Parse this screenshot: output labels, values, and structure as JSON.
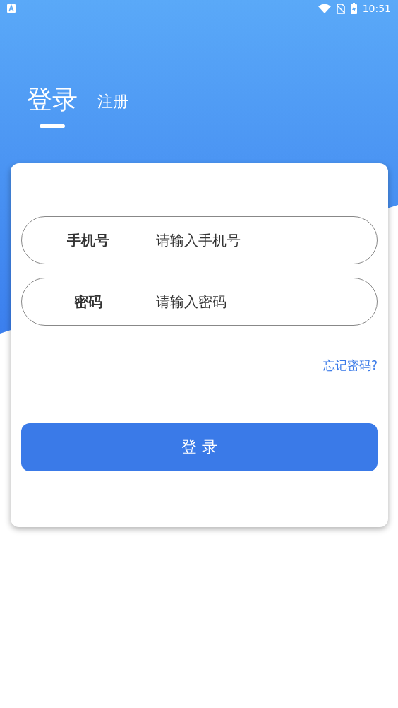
{
  "status_bar": {
    "time": "10:51"
  },
  "tabs": [
    {
      "label": "登录",
      "selected": true
    },
    {
      "label": "注册",
      "selected": false
    }
  ],
  "fields": [
    {
      "label": "手机号",
      "placeholder": "请输入手机号"
    },
    {
      "label": "密码",
      "placeholder": "请输入密码"
    }
  ],
  "forgot_link": "忘记密码?",
  "login_button": "登 录"
}
